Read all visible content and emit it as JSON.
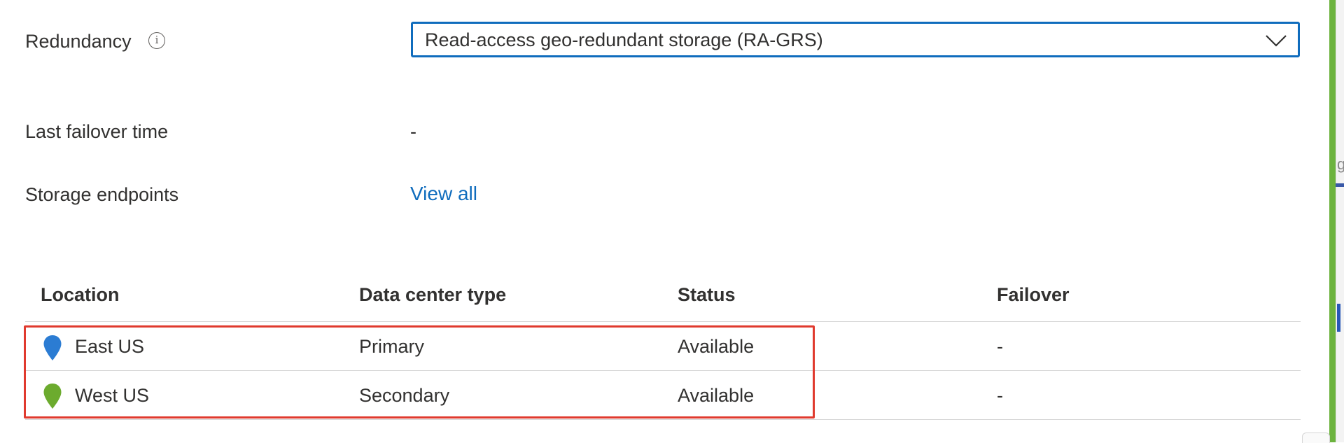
{
  "redundancy": {
    "label": "Redundancy",
    "info_glyph": "i",
    "selected": "Read-access geo-redundant storage (RA-GRS)"
  },
  "failover_time": {
    "label": "Last failover time",
    "value": "-"
  },
  "endpoints": {
    "label": "Storage endpoints",
    "link": "View all"
  },
  "table": {
    "headers": [
      "Location",
      "Data center type",
      "Status",
      "Failover"
    ],
    "rows": [
      {
        "location": "East US",
        "type": "Primary",
        "status": "Available",
        "failover": "-",
        "pin_color": "#2b7cd3"
      },
      {
        "location": "West US",
        "type": "Secondary",
        "status": "Available",
        "failover": "-",
        "pin_color": "#6cab2e"
      }
    ]
  },
  "colors": {
    "accent": "#0f6cbd",
    "highlight_border": "#e03a2e",
    "edge_green": "#6cb33e"
  },
  "edge_fragment": "g"
}
